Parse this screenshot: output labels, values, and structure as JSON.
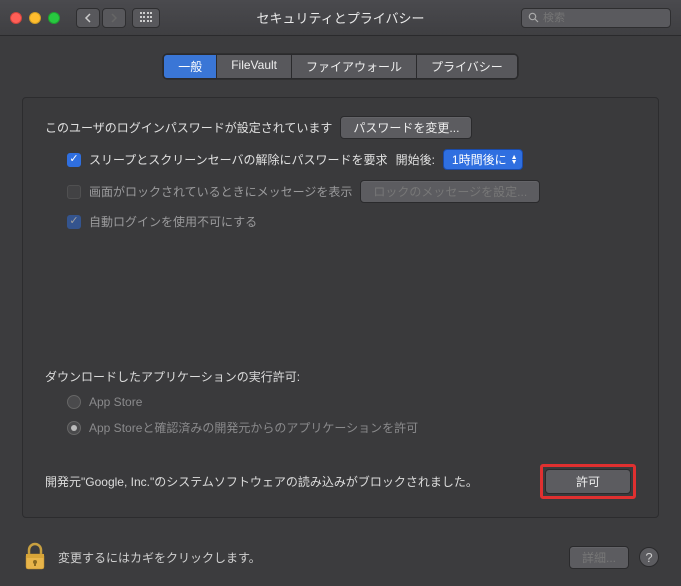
{
  "window": {
    "title": "セキュリティとプライバシー",
    "search_placeholder": "検索"
  },
  "tabs": {
    "general": "一般",
    "filevault": "FileVault",
    "firewall": "ファイアウォール",
    "privacy": "プライバシー"
  },
  "login": {
    "password_set": "このユーザのログインパスワードが設定されています",
    "change_password": "パスワードを変更...",
    "require_password": "スリープとスクリーンセーバの解除にパスワードを要求",
    "start_after_label": "開始後:",
    "start_after_value": "1時間後に",
    "show_message": "画面がロックされているときにメッセージを表示",
    "set_lock_message": "ロックのメッセージを設定...",
    "disable_autologin": "自動ログインを使用不可にする"
  },
  "download": {
    "title": "ダウンロードしたアプリケーションの実行許可:",
    "appstore": "App Store",
    "identified": "App Storeと確認済みの開発元からのアプリケーションを許可"
  },
  "blocked": {
    "text": "開発元\"Google, Inc.\"のシステムソフトウェアの読み込みがブロックされました。",
    "allow": "許可"
  },
  "footer": {
    "lock_text": "変更するにはカギをクリックします。",
    "details": "詳細...",
    "help": "?"
  }
}
